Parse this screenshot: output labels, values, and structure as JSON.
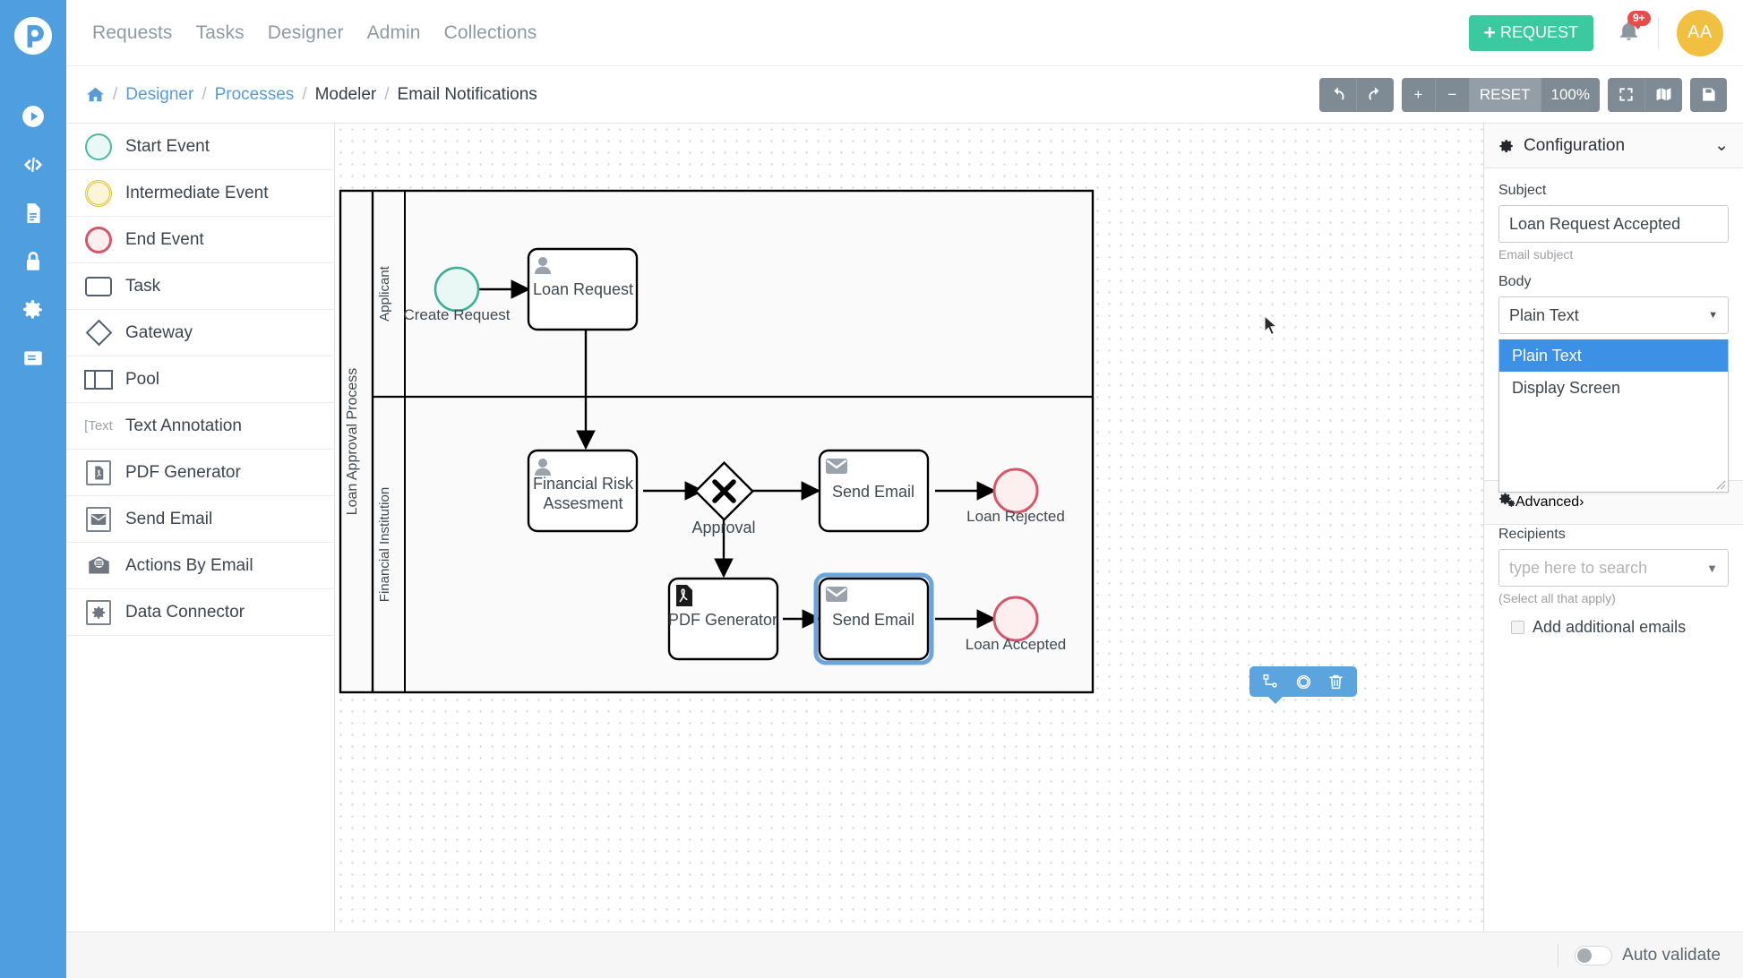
{
  "brand": {
    "logo": "processmaker-logo",
    "color": "#4f9fe0"
  },
  "rail": {
    "items": [
      {
        "name": "requests-play-icon",
        "icon": "play-circle"
      },
      {
        "name": "designer-code-icon",
        "icon": "code-brackets"
      },
      {
        "name": "documents-icon",
        "icon": "document"
      },
      {
        "name": "security-lock-icon",
        "icon": "lock"
      },
      {
        "name": "settings-gear-icon",
        "icon": "gear"
      },
      {
        "name": "collections-book-icon",
        "icon": "book"
      }
    ]
  },
  "topnav": {
    "links": [
      "Requests",
      "Tasks",
      "Designer",
      "Admin",
      "Collections"
    ],
    "request_button": "REQUEST",
    "request_plus": "+",
    "notification_badge": "9+",
    "avatar_initials": "AA"
  },
  "breadcrumb": {
    "home_icon": "home-icon",
    "separator": "/",
    "items": [
      {
        "label": "Designer",
        "link": true
      },
      {
        "label": "Processes",
        "link": true
      },
      {
        "label": "Modeler",
        "link": false
      },
      {
        "label": "Email Notifications",
        "link": false
      }
    ]
  },
  "toolbar": {
    "undo": "undo-icon",
    "redo": "redo-icon",
    "zoom_in": "+",
    "zoom_out": "−",
    "reset": "RESET",
    "zoom_level": "100%",
    "fit_screen": "fit-screen-icon",
    "mini_map": "mini-map-icon",
    "save": "save-icon"
  },
  "palette": {
    "items": [
      {
        "label": "Start Event",
        "icon": "start-event-circle"
      },
      {
        "label": "Intermediate Event",
        "icon": "intermediate-event-circle"
      },
      {
        "label": "End Event",
        "icon": "end-event-circle"
      },
      {
        "label": "Task",
        "icon": "task-rectangle"
      },
      {
        "label": "Gateway",
        "icon": "gateway-diamond"
      },
      {
        "label": "Pool",
        "icon": "pool-rectangle"
      },
      {
        "label": "Text Annotation",
        "icon": "text-annotation",
        "glyph": "[Text"
      },
      {
        "label": "PDF Generator",
        "icon": "pdf-generator-icon"
      },
      {
        "label": "Send Email",
        "icon": "send-email-envelope-icon"
      },
      {
        "label": "Actions By Email",
        "icon": "actions-by-email-icon"
      },
      {
        "label": "Data Connector",
        "icon": "data-connector-icon"
      }
    ]
  },
  "diagram": {
    "pool_label": "Loan Approval Process",
    "lanes": [
      {
        "label": "Applicant"
      },
      {
        "label": "Financial Institution"
      }
    ],
    "nodes": [
      {
        "id": "create-request",
        "type": "start-event",
        "label": "Create Request"
      },
      {
        "id": "loan-request",
        "type": "user-task",
        "label": "Loan Request"
      },
      {
        "id": "financial-risk-assessment",
        "type": "user-task",
        "label": "Financial Risk\nAssesment",
        "line1": "Financial Risk",
        "line2": "Assesment"
      },
      {
        "id": "approval",
        "type": "exclusive-gateway",
        "label": "Approval"
      },
      {
        "id": "send-email-rejected",
        "type": "send-email-task",
        "label": "Send Email"
      },
      {
        "id": "loan-rejected",
        "type": "end-event",
        "label": "Loan Rejected"
      },
      {
        "id": "pdf-generator",
        "type": "pdf-generator-task",
        "label": "PDF Generator"
      },
      {
        "id": "send-email-accepted",
        "type": "send-email-task",
        "label": "Send Email",
        "selected": true
      },
      {
        "id": "loan-accepted",
        "type": "end-event",
        "label": "Loan Accepted"
      }
    ],
    "element_toolbar": [
      {
        "name": "sequence-flow-icon"
      },
      {
        "name": "boundary-event-circle-icon"
      },
      {
        "name": "delete-trash-icon"
      }
    ]
  },
  "config": {
    "header_title": "Configuration",
    "header_icon": "gear-icon",
    "header_chevron": "⌄",
    "subject_label": "Subject",
    "subject_value": "Loan Request Accepted",
    "subject_help": "Email subject",
    "body_label": "Body",
    "body_value": "Plain Text",
    "body_options": [
      "Plain Text",
      "Display Screen"
    ],
    "body_selected_index": 0,
    "recipients_label": "Recipients",
    "recipients_placeholder": "type here to search",
    "recipients_help": "(Select all that apply)",
    "add_emails_label": "Add additional emails",
    "add_emails_checked": false,
    "advanced_label": "Advanced",
    "advanced_icon": "advanced-gears-icon",
    "advanced_chevron": "›",
    "highlight_color": "#3c91e6"
  },
  "bottom": {
    "auto_validate_label": "Auto validate",
    "auto_validate_on": false
  }
}
